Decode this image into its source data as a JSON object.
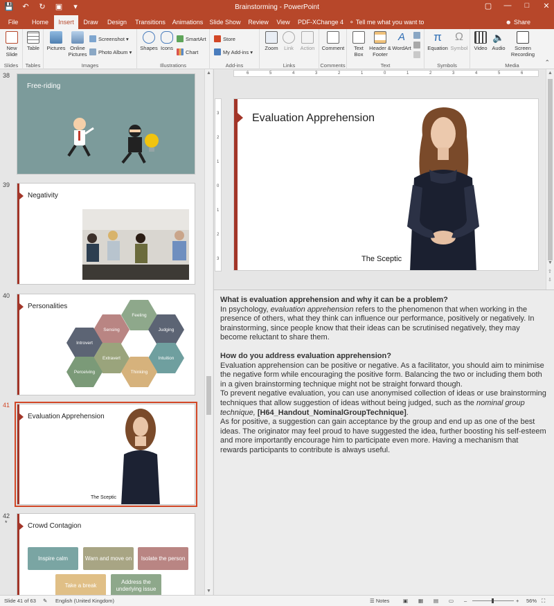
{
  "window": {
    "title": "Brainstorming - PowerPoint",
    "quick_access": [
      "save-icon",
      "undo-icon",
      "redo-icon",
      "start-from-beginning-icon",
      "customize-icon"
    ],
    "controls": [
      "ribbon-display-icon",
      "minimize-icon",
      "maximize-icon",
      "close-icon"
    ]
  },
  "tabs": [
    "File",
    "Home",
    "Insert",
    "Draw",
    "Design",
    "Transitions",
    "Animations",
    "Slide Show",
    "Review",
    "View",
    "PDF-XChange 4"
  ],
  "active_tab": "Insert",
  "tell_me": "Tell me what you want to do",
  "share": "Share",
  "ribbon": {
    "groups": {
      "slides": "Slides",
      "tables": "Tables",
      "images": "Images",
      "illustrations": "Illustrations",
      "addins": "Add-ins",
      "links": "Links",
      "comments": "Comments",
      "text": "Text",
      "symbols": "Symbols",
      "media": "Media"
    },
    "buttons": {
      "new_slide": "New Slide",
      "table": "Table",
      "pictures": "Pictures",
      "online_pictures": "Online Pictures",
      "screenshot": "Screenshot",
      "photo_album": "Photo Album",
      "shapes": "Shapes",
      "icons": "Icons",
      "smartart": "SmartArt",
      "chart": "Chart",
      "store": "Store",
      "my_addins": "My Add-ins",
      "zoom": "Zoom",
      "link": "Link",
      "action": "Action",
      "comment": "Comment",
      "text_box": "Text Box",
      "header_footer": "Header & Footer",
      "wordart": "WordArt",
      "equation": "Equation",
      "symbol": "Symbol",
      "video": "Video",
      "audio": "Audio",
      "screen_recording": "Screen Recording"
    }
  },
  "thumbnails": [
    {
      "number": "38",
      "title": "Free-riding"
    },
    {
      "number": "39",
      "title": "Negativity"
    },
    {
      "number": "40",
      "title": "Personalities",
      "hexagons": [
        "Feeling",
        "Sensing",
        "Judging",
        "Introvert",
        "Extravert",
        "Intuition",
        "Perceiving",
        "Thinking"
      ]
    },
    {
      "number": "41",
      "title": "Evaluation Apprehension",
      "caption": "The Sceptic",
      "selected": true
    },
    {
      "number": "42",
      "star": "*",
      "title": "Crowd Contagion",
      "boxes": [
        "Inspire calm",
        "Warn and move on",
        "Isolate the person",
        "Take a break",
        "Address the underlying issue"
      ]
    }
  ],
  "slide": {
    "title": "Evaluation Apprehension",
    "caption": "The Sceptic"
  },
  "hruler_labels": [
    "6",
    "5",
    "4",
    "3",
    "2",
    "1",
    "0",
    "1",
    "2",
    "3",
    "4",
    "5",
    "6"
  ],
  "vruler_labels": [
    "3",
    "2",
    "1",
    "0",
    "1",
    "2",
    "3"
  ],
  "notes": {
    "h1": "What is evaluation apprehension and why it can be a problem?",
    "p1a": "In psychology, ",
    "p1em": "evaluation apprehension",
    "p1b": " refers to the phenomenon that when working in the presence of others, what they think can influence our performance, positively or negatively. In brainstorming, since people know that their ideas can be scrutinised negatively, they may become reluctant to share  them.",
    "h2": "How do you address evaluation apprehension?",
    "p2": "Evaluation apprehension can be positive or negative. As a facilitator, you should aim to minimise the negative form while encouraging the positive form. Balancing the two or including them both in a given brainstorming technique might not be straight forward though.",
    "p3a": "To prevent negative evaluation, you can use anonymised collection of ideas or use brainstorming techniques that allow suggestion of ideas without being judged, such as the ",
    "p3em": "nominal group technique,",
    "p3b": "  [H64_Handout_NominalGroupTechnique]",
    "p3c": ".",
    "p4": "As for positive, a suggestion can gain acceptance by the group and end up as one of the best ideas. The originator may feel proud to have suggested the idea, further boosting his self-esteem and more importantly encourage him to participate even more. Having a mechanism that rewards participants to contribute is always useful."
  },
  "status": {
    "slide_count": "Slide 41 of 63",
    "language": "English (United Kingdom)",
    "notes": "Notes",
    "zoom": "56%"
  },
  "colors": {
    "accent": "#b7472a",
    "slide_bar": "#a23528",
    "selection": "#d24726"
  }
}
